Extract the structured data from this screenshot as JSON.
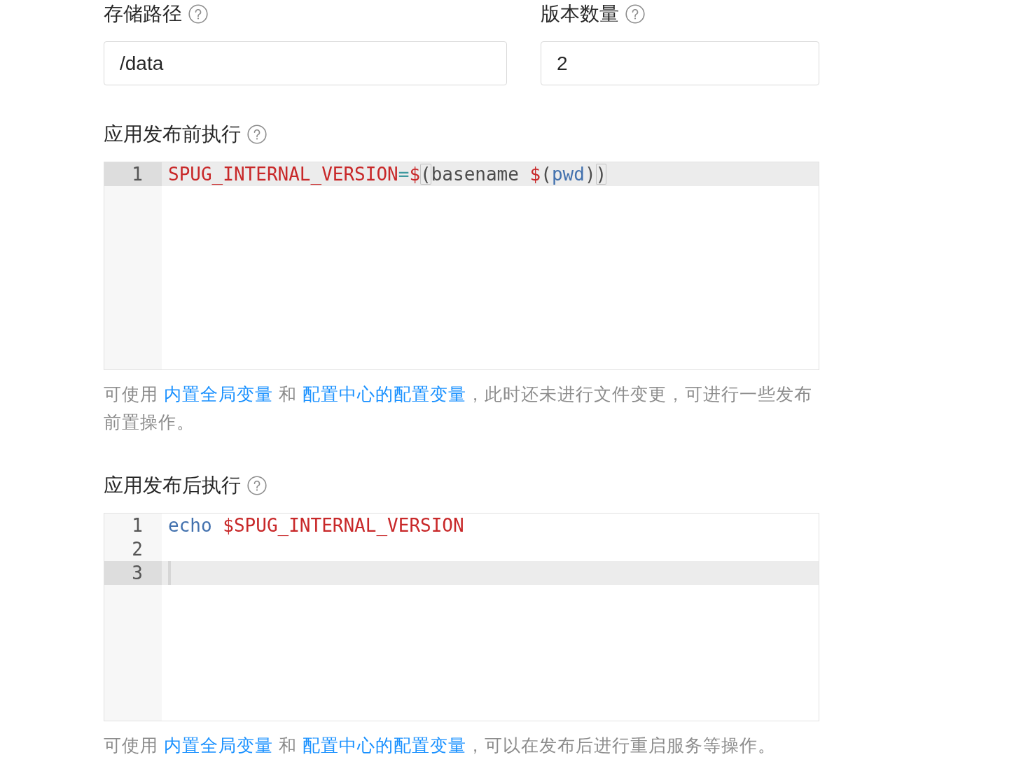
{
  "fields": [
    {
      "label": "存储路径",
      "value": "/data"
    },
    {
      "label": "版本数量",
      "value": "2"
    }
  ],
  "editors": [
    {
      "label": "应用发布前执行",
      "lines": [
        {
          "number": "1",
          "active": true,
          "cursor": false,
          "tokens": [
            {
              "kind": "variable",
              "text": "SPUG_INTERNAL_VERSION"
            },
            {
              "kind": "operator",
              "text": "="
            },
            {
              "kind": "variable",
              "text": "$"
            },
            {
              "kind": "matched-bracket",
              "text": "("
            },
            {
              "kind": "plain",
              "text": "basename "
            },
            {
              "kind": "variable",
              "text": "$"
            },
            {
              "kind": "plain",
              "text": "("
            },
            {
              "kind": "builtin",
              "text": "pwd"
            },
            {
              "kind": "plain",
              "text": ")"
            },
            {
              "kind": "matched-bracket",
              "text": ")"
            }
          ]
        }
      ],
      "help": [
        {
          "kind": "text",
          "text": "可使用 "
        },
        {
          "kind": "link",
          "text": "内置全局变量"
        },
        {
          "kind": "text",
          "text": " 和 "
        },
        {
          "kind": "link",
          "text": "配置中心的配置变量"
        },
        {
          "kind": "text",
          "text": "，此时还未进行文件变更，可进行一些发布前置操作。"
        }
      ]
    },
    {
      "label": "应用发布后执行",
      "lines": [
        {
          "number": "1",
          "active": false,
          "cursor": false,
          "tokens": [
            {
              "kind": "builtin",
              "text": "echo "
            },
            {
              "kind": "variable",
              "text": "$SPUG_INTERNAL_VERSION"
            }
          ]
        },
        {
          "number": "2",
          "active": false,
          "cursor": false
        },
        {
          "number": "3",
          "active": true,
          "cursor": true
        }
      ],
      "help": [
        {
          "kind": "text",
          "text": "可使用 "
        },
        {
          "kind": "link",
          "text": "内置全局变量"
        },
        {
          "kind": "text",
          "text": " 和 "
        },
        {
          "kind": "link",
          "text": "配置中心的配置变量"
        },
        {
          "kind": "text",
          "text": "，可以在发布后进行重启服务等操作。"
        }
      ]
    }
  ]
}
